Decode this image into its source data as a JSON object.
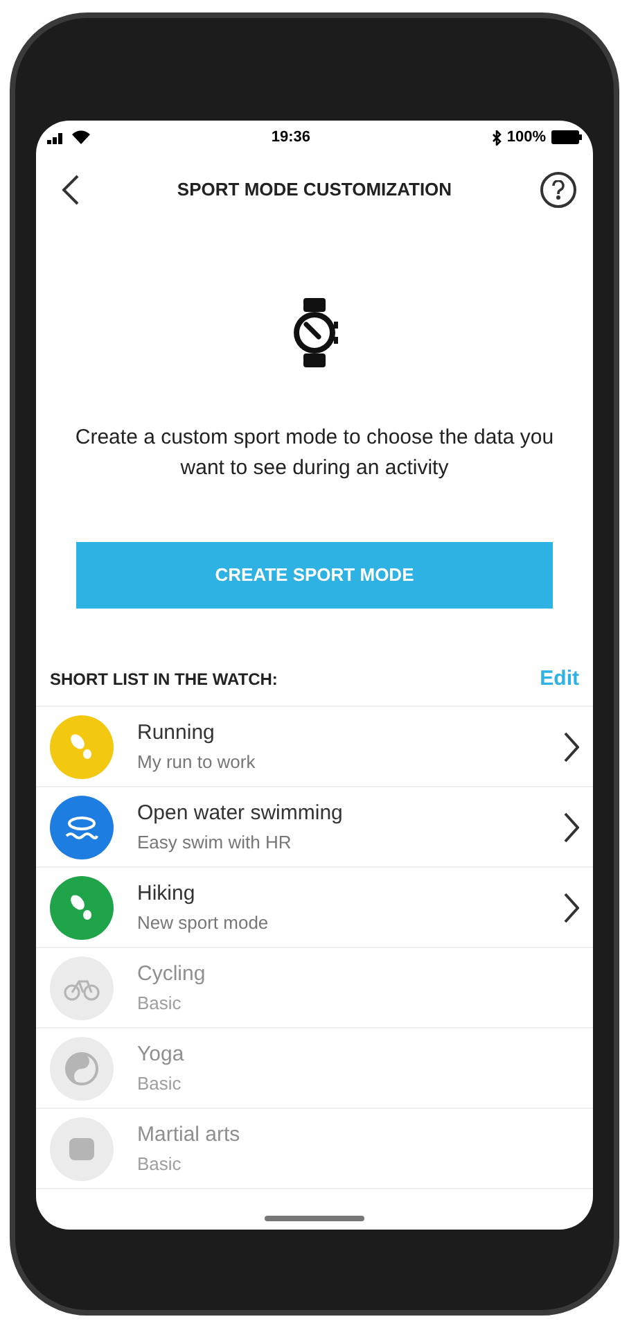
{
  "status_bar": {
    "time": "19:36",
    "battery": "100%"
  },
  "header": {
    "title": "SPORT MODE CUSTOMIZATION"
  },
  "intro": {
    "text": "Create a custom sport mode to choose the data you want to see during an activity",
    "button": "CREATE SPORT MODE"
  },
  "short_list": {
    "title": "SHORT LIST IN THE WATCH:",
    "edit": "Edit",
    "items": [
      {
        "name": "Running",
        "subtitle": "My run to work",
        "color": "#f2c811",
        "disabled": false
      },
      {
        "name": "Open water swimming",
        "subtitle": "Easy swim with HR",
        "color": "#1e7de1",
        "disabled": false
      },
      {
        "name": "Hiking",
        "subtitle": "New sport mode",
        "color": "#1fa44a",
        "disabled": false
      },
      {
        "name": "Cycling",
        "subtitle": "Basic",
        "color": "#ebebeb",
        "disabled": true
      },
      {
        "name": "Yoga",
        "subtitle": "Basic",
        "color": "#ebebeb",
        "disabled": true
      },
      {
        "name": "Martial arts",
        "subtitle": "Basic",
        "color": "#ebebeb",
        "disabled": true
      }
    ]
  }
}
